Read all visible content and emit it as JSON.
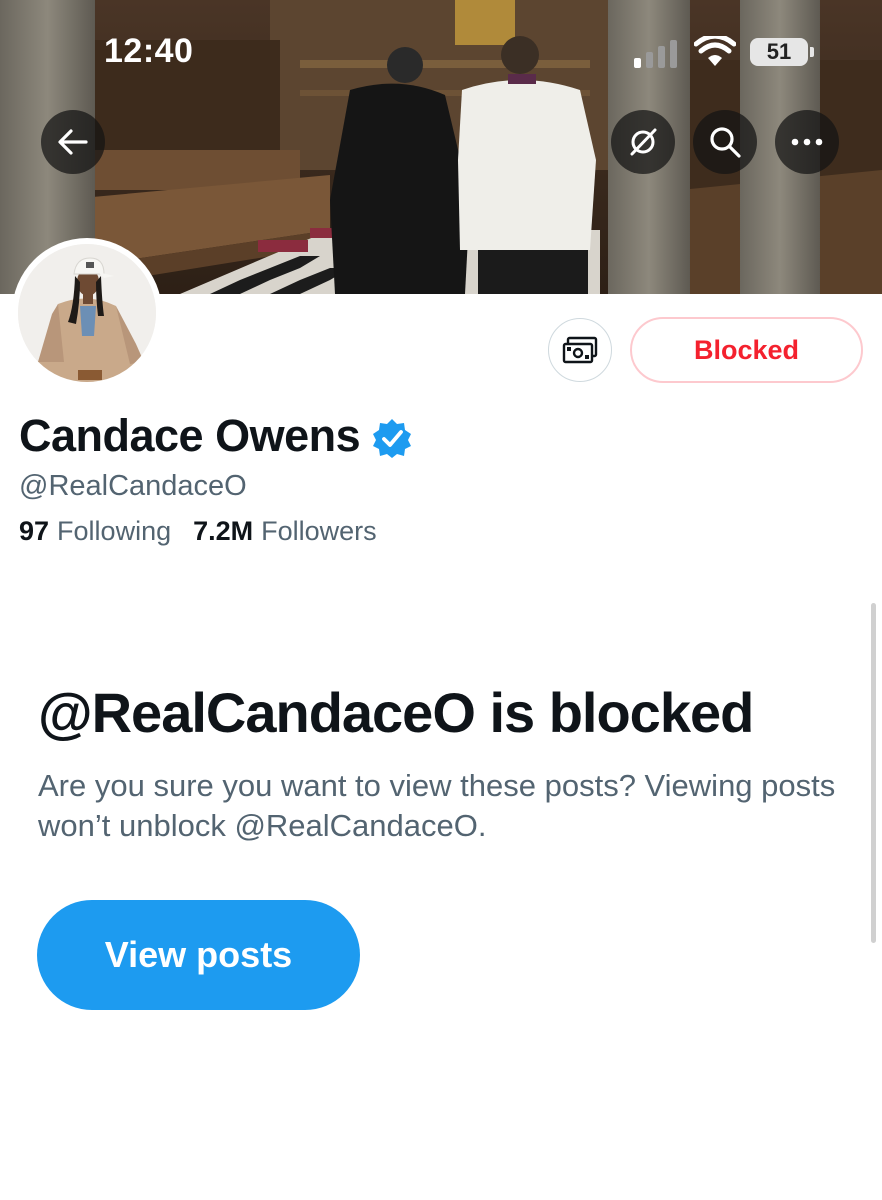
{
  "status_bar": {
    "time": "12:40",
    "battery_level": "51",
    "icons": [
      "signal-icon",
      "wifi-icon",
      "battery-icon"
    ]
  },
  "header": {
    "buttons": [
      "back-arrow-icon",
      "grok-icon",
      "search-icon",
      "more-icon"
    ]
  },
  "profile": {
    "display_name": "Candace Owens",
    "handle": "@RealCandaceO",
    "verified": true,
    "following_count": "97",
    "following_label": "Following",
    "followers_count": "7.2M",
    "followers_label": "Followers",
    "tip_icon": "money-icon",
    "blocked_label": "Blocked"
  },
  "blocked_notice": {
    "title": "@RealCandaceO is blocked",
    "description": "Are you sure you want to view these posts? Viewing posts won’t unblock @RealCandaceO.",
    "button_label": "View posts"
  },
  "colors": {
    "accent": "#1d9bf0",
    "blocked_red": "#f4212e",
    "secondary_text": "#536471",
    "primary_text": "#0f1419"
  }
}
